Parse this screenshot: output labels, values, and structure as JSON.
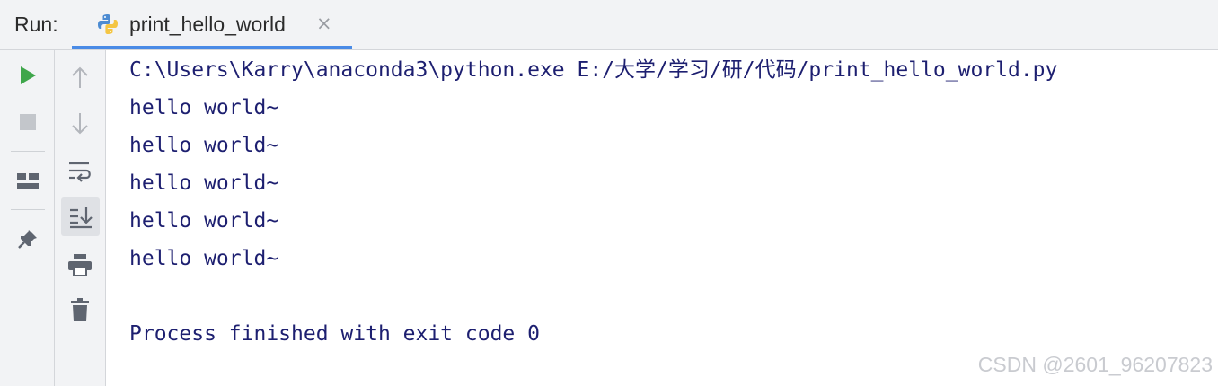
{
  "header": {
    "run_label": "Run:",
    "tab": {
      "title": "print_hello_world",
      "close": "×",
      "icon": "python-icon"
    }
  },
  "left_toolbar": [
    {
      "name": "rerun-icon",
      "color": "#3fa64b"
    },
    {
      "name": "stop-icon",
      "color": "#b9bcc1"
    },
    {
      "name": "layout-icon",
      "color": "#5f6570"
    },
    {
      "name": "pin-icon",
      "color": "#5f6570"
    }
  ],
  "console_toolbar": [
    {
      "name": "up-arrow-icon"
    },
    {
      "name": "down-arrow-icon"
    },
    {
      "name": "soft-wrap-icon"
    },
    {
      "name": "scroll-to-end-icon",
      "active": true
    },
    {
      "name": "print-icon"
    },
    {
      "name": "trash-icon"
    }
  ],
  "console": {
    "command": "C:\\Users\\Karry\\anaconda3\\python.exe E:/大学/学习/研/代码/print_hello_world.py",
    "output": [
      "hello world~",
      "hello world~",
      "hello world~",
      "hello world~",
      "hello world~"
    ],
    "exit_message": "Process finished with exit code 0"
  },
  "watermark": "CSDN @2601_96207823",
  "colors": {
    "accent": "#4a8be6",
    "console_text": "#1d1f70",
    "run_green": "#3fa64b"
  }
}
